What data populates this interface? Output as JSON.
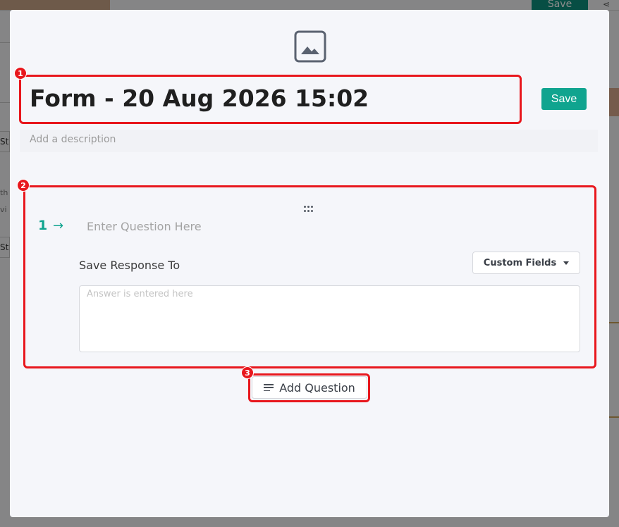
{
  "background": {
    "save_label": "Save",
    "share_icon": "share-icon",
    "tab_label_1": "Ste",
    "tab_label_2": "Ste",
    "side_text": "th vi"
  },
  "modal": {
    "cover_icon": "image-placeholder-icon",
    "title": "Form - 20 Aug 2026 15:02",
    "save_label": "Save",
    "description_placeholder": "Add a description",
    "question": {
      "number": "1",
      "arrow": "→",
      "placeholder": "Enter Question Here",
      "save_response_label": "Save Response To",
      "custom_fields_label": "Custom Fields",
      "answer_placeholder": "Answer is entered here"
    },
    "add_question_label": "Add Question"
  },
  "annotations": [
    "1",
    "2",
    "3"
  ],
  "colors": {
    "accent": "#10a48f",
    "annotation": "#e8171d",
    "modal_bg": "#f5f6fa"
  }
}
